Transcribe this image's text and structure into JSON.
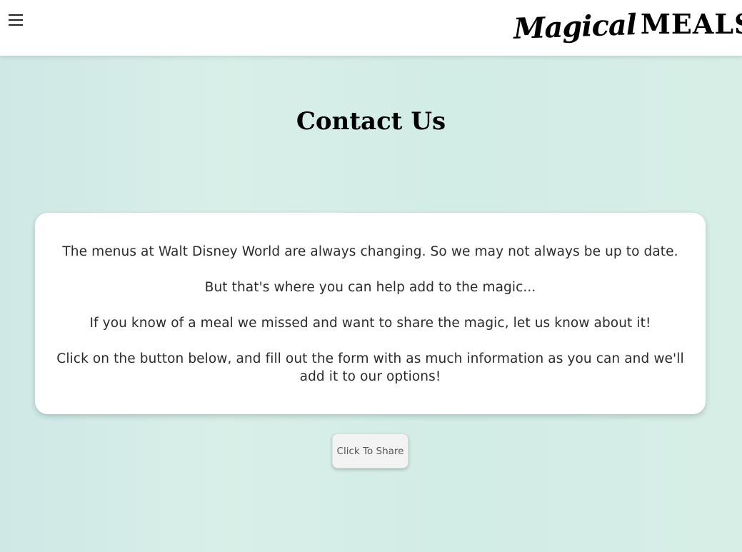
{
  "header": {
    "menu_icon": "hamburger-menu-icon",
    "logo": {
      "word1": "Magical",
      "word2": "MEALS",
      "leaf_icon": "leaf-icon",
      "leaf_color": "#1a9a3a"
    }
  },
  "main": {
    "title": "Contact Us",
    "paragraphs": [
      "The menus at Walt Disney World are always changing. So we may not always be up to date.",
      "But that's where you can help add to the magic...",
      "If you know of a meal we missed and want to share the magic, let us know about it!",
      "Click on the button below, and fill out the form with as much information as you can and we'll add it to our options!"
    ],
    "share_button_label": "Click To Share"
  },
  "colors": {
    "background": "#d3ece7",
    "card": "#ffffff",
    "header": "#ffffff"
  }
}
